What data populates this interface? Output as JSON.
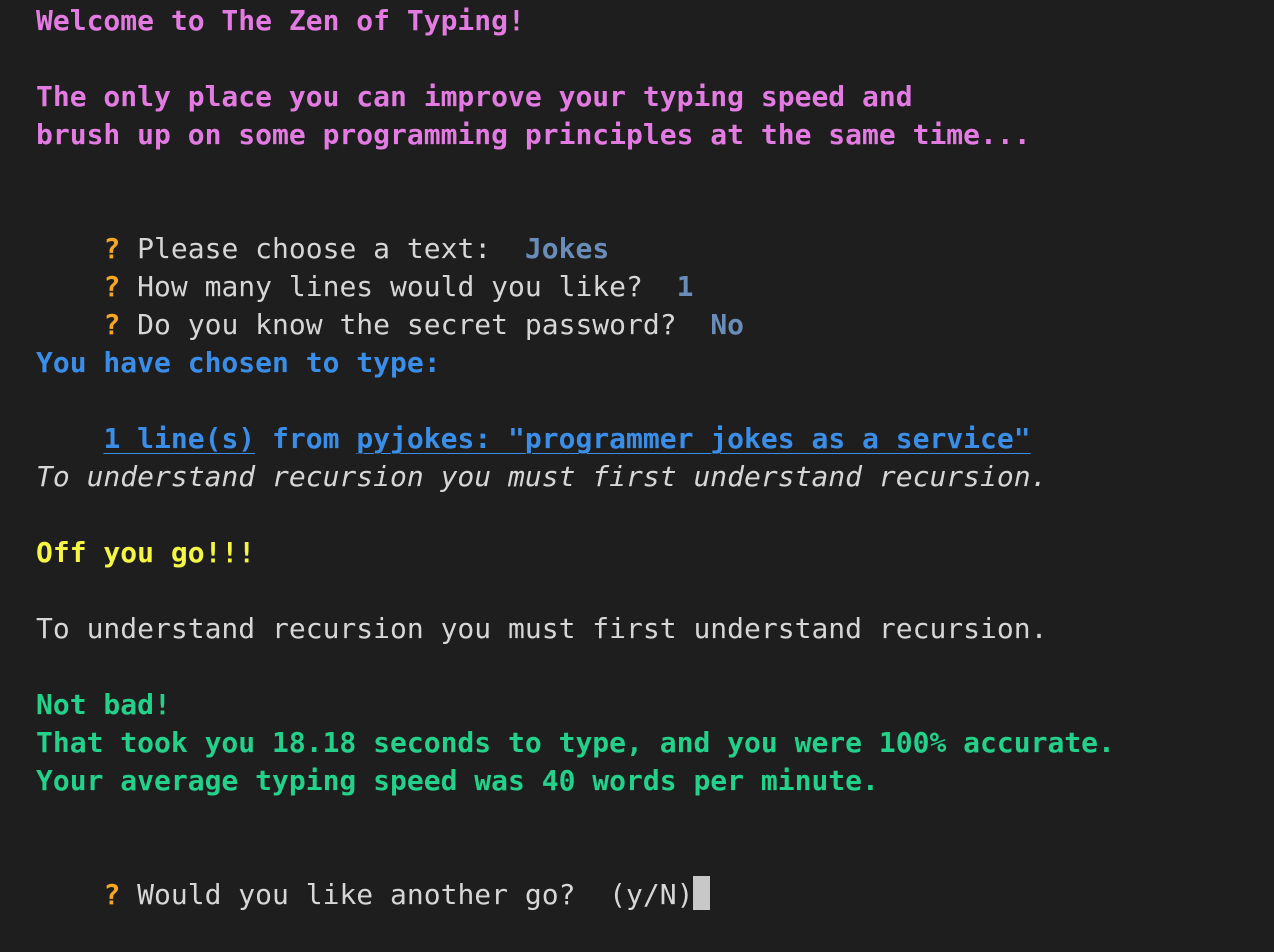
{
  "intro": {
    "welcome": "Welcome to The Zen of Typing!",
    "tagline_line1": "The only place you can improve your typing speed and",
    "tagline_line2": "brush up on some programming principles at the same time..."
  },
  "prompts": [
    {
      "mark": "?",
      "question": "Please choose a text:  ",
      "answer": "Jokes"
    },
    {
      "mark": "?",
      "question": "How many lines would you like?  ",
      "answer": "1"
    },
    {
      "mark": "?",
      "question": "Do you know the secret password?  ",
      "answer": "No"
    }
  ],
  "choice": {
    "heading": "You have chosen to type:",
    "lines_link": "1 line(s)",
    "from_text": " from ",
    "source_link": "pyjokes: \"programmer jokes as a service\""
  },
  "target_text": "To understand recursion you must first understand recursion.",
  "go_message": "Off you go!!!",
  "typed_text": "To understand recursion you must first understand recursion.",
  "results": {
    "verdict": "Not bad!",
    "time_line": "That took you 18.18 seconds to type, and you were 100% accurate.",
    "speed_line": "Your average typing speed was 40 words per minute."
  },
  "final_prompt": {
    "mark": "?",
    "question": "Would you like another go?  (y/N)"
  },
  "colors": {
    "background": "#1e1e1e",
    "magenta": "#e37be3",
    "blue": "#3b8ee8",
    "yellow": "#f5f545",
    "green": "#23d18b",
    "question_mark": "#f5a623",
    "answer": "#6a8cb8"
  }
}
